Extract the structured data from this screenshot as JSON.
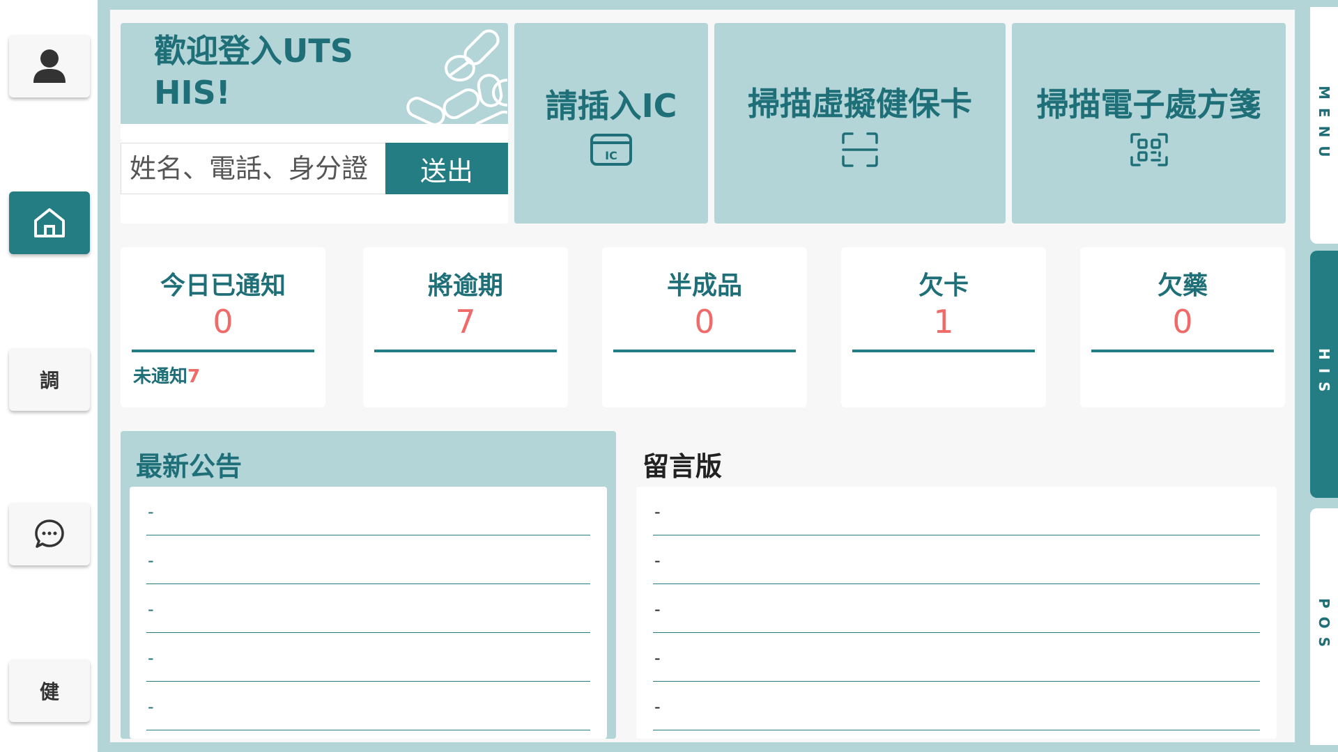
{
  "sidebar": {
    "items": [
      {
        "name": "profile",
        "icon": "user-icon"
      },
      {
        "name": "home",
        "icon": "home-icon"
      },
      {
        "name": "adjust",
        "label": "調"
      },
      {
        "name": "chat",
        "icon": "chat-icon"
      },
      {
        "name": "health",
        "label": "健"
      }
    ]
  },
  "welcome": {
    "title": "歡迎登入UTS HIS!",
    "search_placeholder": "姓名、電話、身分證",
    "submit_label": "送出"
  },
  "actions": [
    {
      "label": "請插入IC",
      "icon": "ic-card-icon",
      "icon_text": "IC"
    },
    {
      "label": "掃描虛擬健保卡",
      "icon": "scan-frame-icon"
    },
    {
      "label": "掃描電子處方箋",
      "icon": "qr-scan-icon"
    }
  ],
  "stats": [
    {
      "title": "今日已通知",
      "value": "0",
      "sub_label": "未通知",
      "sub_value": "7"
    },
    {
      "title": "將逾期",
      "value": "7"
    },
    {
      "title": "半成品",
      "value": "0"
    },
    {
      "title": "欠卡",
      "value": "1"
    },
    {
      "title": "欠藥",
      "value": "0"
    }
  ],
  "announcements": {
    "title": "最新公告",
    "rows": [
      "-",
      "-",
      "-",
      "-",
      "-"
    ]
  },
  "messages": {
    "title": "留言版",
    "rows": [
      "-",
      "-",
      "-",
      "-",
      "-"
    ]
  },
  "right_tabs": [
    {
      "label": "MENU",
      "active": false
    },
    {
      "label": "HIS",
      "active": true
    },
    {
      "label": "POS",
      "active": false
    }
  ],
  "colors": {
    "primary": "#237d83",
    "light": "#b3d5d8",
    "accent_red": "#f06a6a"
  }
}
